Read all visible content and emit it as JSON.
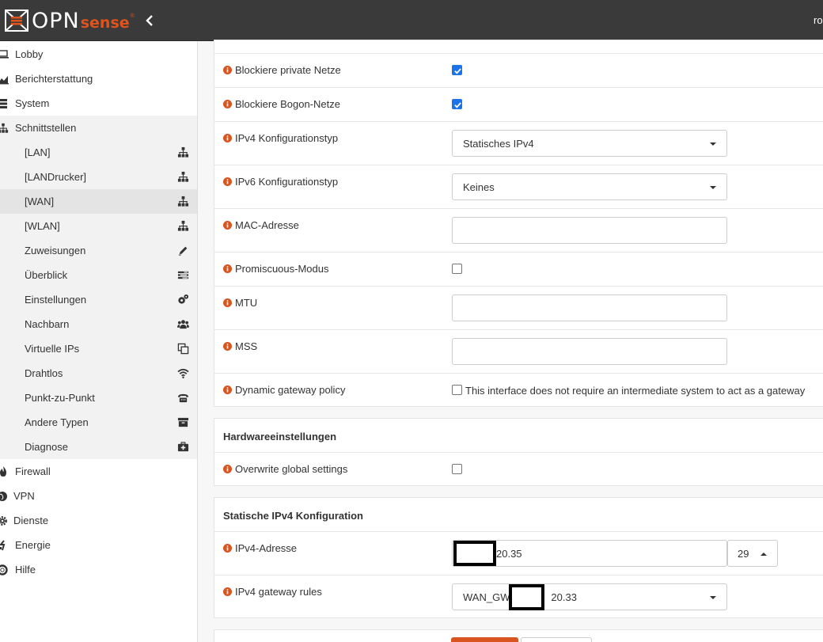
{
  "header": {
    "logo_main": "OPN",
    "logo_accent": "sense",
    "logo_reg": "®",
    "user_label": "ro"
  },
  "sidebar": {
    "items": [
      {
        "label": "Lobby",
        "icon": "laptop-icon"
      },
      {
        "label": "Berichterstattung",
        "icon": "area-chart-icon"
      },
      {
        "label": "System",
        "icon": "server-icon"
      },
      {
        "label": "Schnittstellen",
        "icon": "sitemap-icon"
      },
      {
        "label": "Firewall",
        "icon": "fire-icon"
      },
      {
        "label": "VPN",
        "icon": "globe-icon"
      },
      {
        "label": "Dienste",
        "icon": "cog-icon"
      },
      {
        "label": "Energie",
        "icon": "plug-icon"
      },
      {
        "label": "Hilfe",
        "icon": "life-ring-icon"
      }
    ],
    "sub_items": [
      {
        "label": "[LAN]",
        "icon": "sitemap-icon"
      },
      {
        "label": "[LANDrucker]",
        "icon": "sitemap-icon"
      },
      {
        "label": "[WAN]",
        "icon": "sitemap-icon"
      },
      {
        "label": "[WLAN]",
        "icon": "sitemap-icon"
      },
      {
        "label": "Zuweisungen",
        "icon": "pencil-icon"
      },
      {
        "label": "Überblick",
        "icon": "tasks-icon"
      },
      {
        "label": "Einstellungen",
        "icon": "cogs-icon"
      },
      {
        "label": "Nachbarn",
        "icon": "users-icon"
      },
      {
        "label": "Virtuelle IPs",
        "icon": "clone-icon"
      },
      {
        "label": "Drahtlos",
        "icon": "wifi-icon"
      },
      {
        "label": "Punkt-zu-Punkt",
        "icon": "fax-icon"
      },
      {
        "label": "Andere Typen",
        "icon": "archive-icon"
      },
      {
        "label": "Diagnose",
        "icon": "medkit-icon"
      }
    ]
  },
  "general": {
    "block_private": {
      "label": "Blockiere private Netze",
      "checked": true
    },
    "block_bogon": {
      "label": "Blockiere Bogon-Netze",
      "checked": true
    },
    "ipv4_type": {
      "label": "IPv4 Konfigurationstyp",
      "value": "Statisches IPv4"
    },
    "ipv6_type": {
      "label": "IPv6 Konfigurationstyp",
      "value": "Keines"
    },
    "mac": {
      "label": "MAC-Adresse",
      "value": ""
    },
    "promisc": {
      "label": "Promiscuous-Modus",
      "checked": false
    },
    "mtu": {
      "label": "MTU",
      "value": ""
    },
    "mss": {
      "label": "MSS",
      "value": ""
    },
    "dynamic_gw": {
      "label": "Dynamic gateway policy",
      "checked": false,
      "text": "This interface does not require an intermediate system to act as a gateway"
    }
  },
  "hardware": {
    "title": "Hardwareeinstellungen",
    "overwrite": {
      "label": "Overwrite global settings",
      "checked": false
    }
  },
  "static_ipv4": {
    "title": "Statische IPv4 Konfiguration",
    "address": {
      "label": "IPv4-Adresse",
      "value_suffix": "20.35",
      "subnet": "29"
    },
    "gateway": {
      "label": "IPv4 gateway rules",
      "value_prefix": "WAN_GW - ",
      "value_suffix": "20.33"
    }
  },
  "colors": {
    "accent": "#d9541e",
    "info_icon": "#d9541e",
    "topbar": "#3a3a3a",
    "checkbox": "#1a73e8"
  }
}
